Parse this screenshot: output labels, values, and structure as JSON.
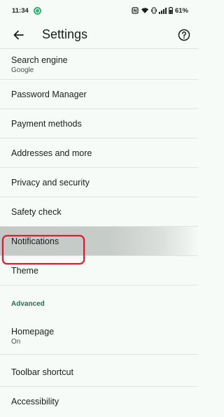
{
  "status_bar": {
    "time": "11:34",
    "battery": "61%",
    "icons": [
      "nfc-icon",
      "wifi-icon",
      "vibrate-icon",
      "signal-icon",
      "battery-icon"
    ]
  },
  "app_bar": {
    "title": "Settings",
    "back_icon": "arrow-back-icon",
    "help_icon": "help-icon"
  },
  "items": [
    {
      "title": "Search engine",
      "subtitle": "Google"
    },
    {
      "title": "Password Manager"
    },
    {
      "title": "Payment methods"
    },
    {
      "title": "Addresses and more"
    },
    {
      "title": "Privacy and security"
    },
    {
      "title": "Safety check"
    },
    {
      "title": "Notifications",
      "highlighted": true
    },
    {
      "title": "Theme"
    }
  ],
  "advanced": {
    "header": "Advanced",
    "items": [
      {
        "title": "Homepage",
        "subtitle": "On"
      },
      {
        "title": "Toolbar shortcut"
      },
      {
        "title": "Accessibility"
      }
    ]
  },
  "colors": {
    "background": "#f6fbf8",
    "section_header": "#2b6a52",
    "highlight_outline": "#e0192a"
  }
}
